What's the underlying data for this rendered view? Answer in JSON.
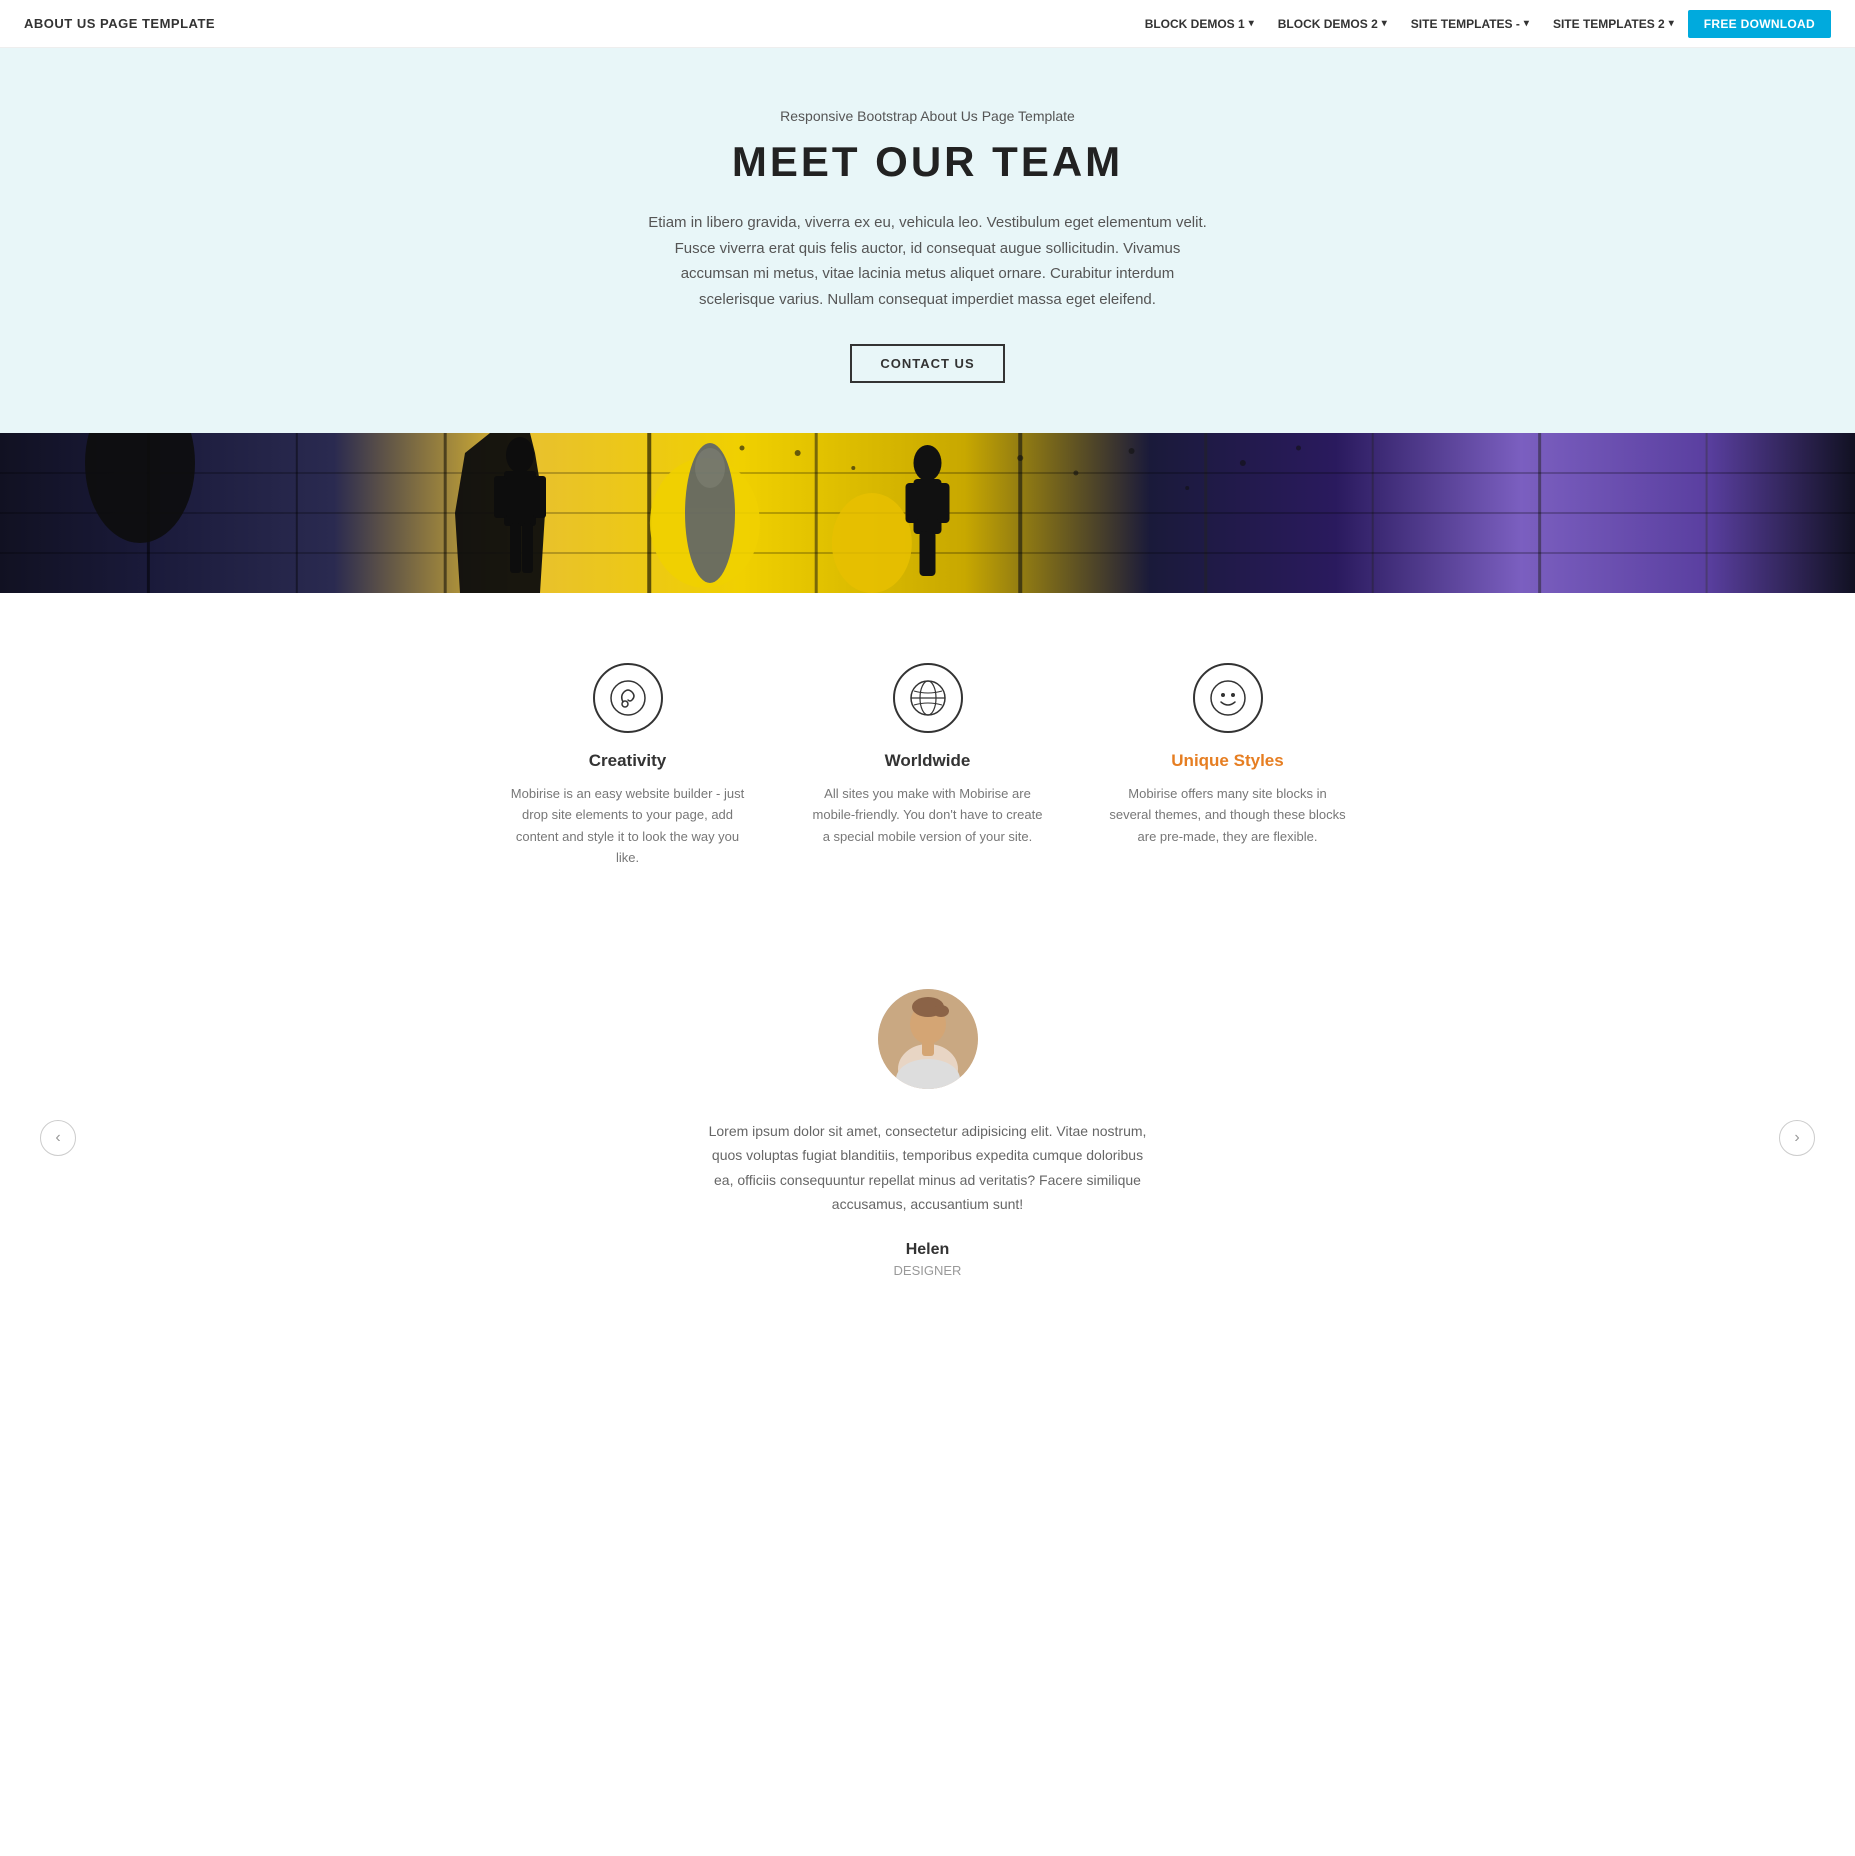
{
  "navbar": {
    "brand": "ABOUT US PAGE TEMPLATE",
    "nav_items": [
      {
        "label": "BLOCK DEMOS 1",
        "has_dropdown": true
      },
      {
        "label": "BLOCK DEMOS 2",
        "has_dropdown": true
      },
      {
        "label": "SITE TEMPLATES -",
        "has_dropdown": true
      },
      {
        "label": "SITE TEMPLATES 2",
        "has_dropdown": true
      }
    ],
    "cta_label": "FREE DOWNLOAD"
  },
  "hero": {
    "subtitle": "Responsive Bootstrap About Us Page Template",
    "title": "MEET OUR TEAM",
    "body": "Etiam in libero gravida, viverra ex eu, vehicula leo. Vestibulum eget elementum velit. Fusce viverra erat quis felis auctor, id consequat augue sollicitudin. Vivamus accumsan mi metus, vitae lacinia metus aliquet ornare. Curabitur interdum scelerisque varius. Nullam consequat imperdiet massa eget eleifend.",
    "cta_label": "CONTACT US"
  },
  "features": {
    "items": [
      {
        "icon": "creativity-icon",
        "icon_char": "🎨",
        "title": "Creativity",
        "title_highlight": false,
        "desc": "Mobirise is an easy website builder - just drop site elements to your page, add content and style it to look the way you like."
      },
      {
        "icon": "worldwide-icon",
        "icon_char": "🌍",
        "title": "Worldwide",
        "title_highlight": false,
        "desc": "All sites you make with Mobirise are mobile-friendly. You don't have to create a special mobile version of your site."
      },
      {
        "icon": "unique-styles-icon",
        "icon_char": "😊",
        "title": "Unique Styles",
        "title_highlight": true,
        "desc": "Mobirise offers many site blocks in several themes, and though these blocks are pre-made, they are flexible."
      }
    ]
  },
  "testimonial": {
    "text": "Lorem ipsum dolor sit amet, consectetur adipisicing elit. Vitae nostrum, quos voluptas fugiat blanditiis, temporibus expedita cumque doloribus ea, officiis consequuntur repellat minus ad veritatis? Facere similique accusamus, accusantium sunt!",
    "name": "Helen",
    "role": "DESIGNER",
    "prev_label": "‹",
    "next_label": "›"
  }
}
